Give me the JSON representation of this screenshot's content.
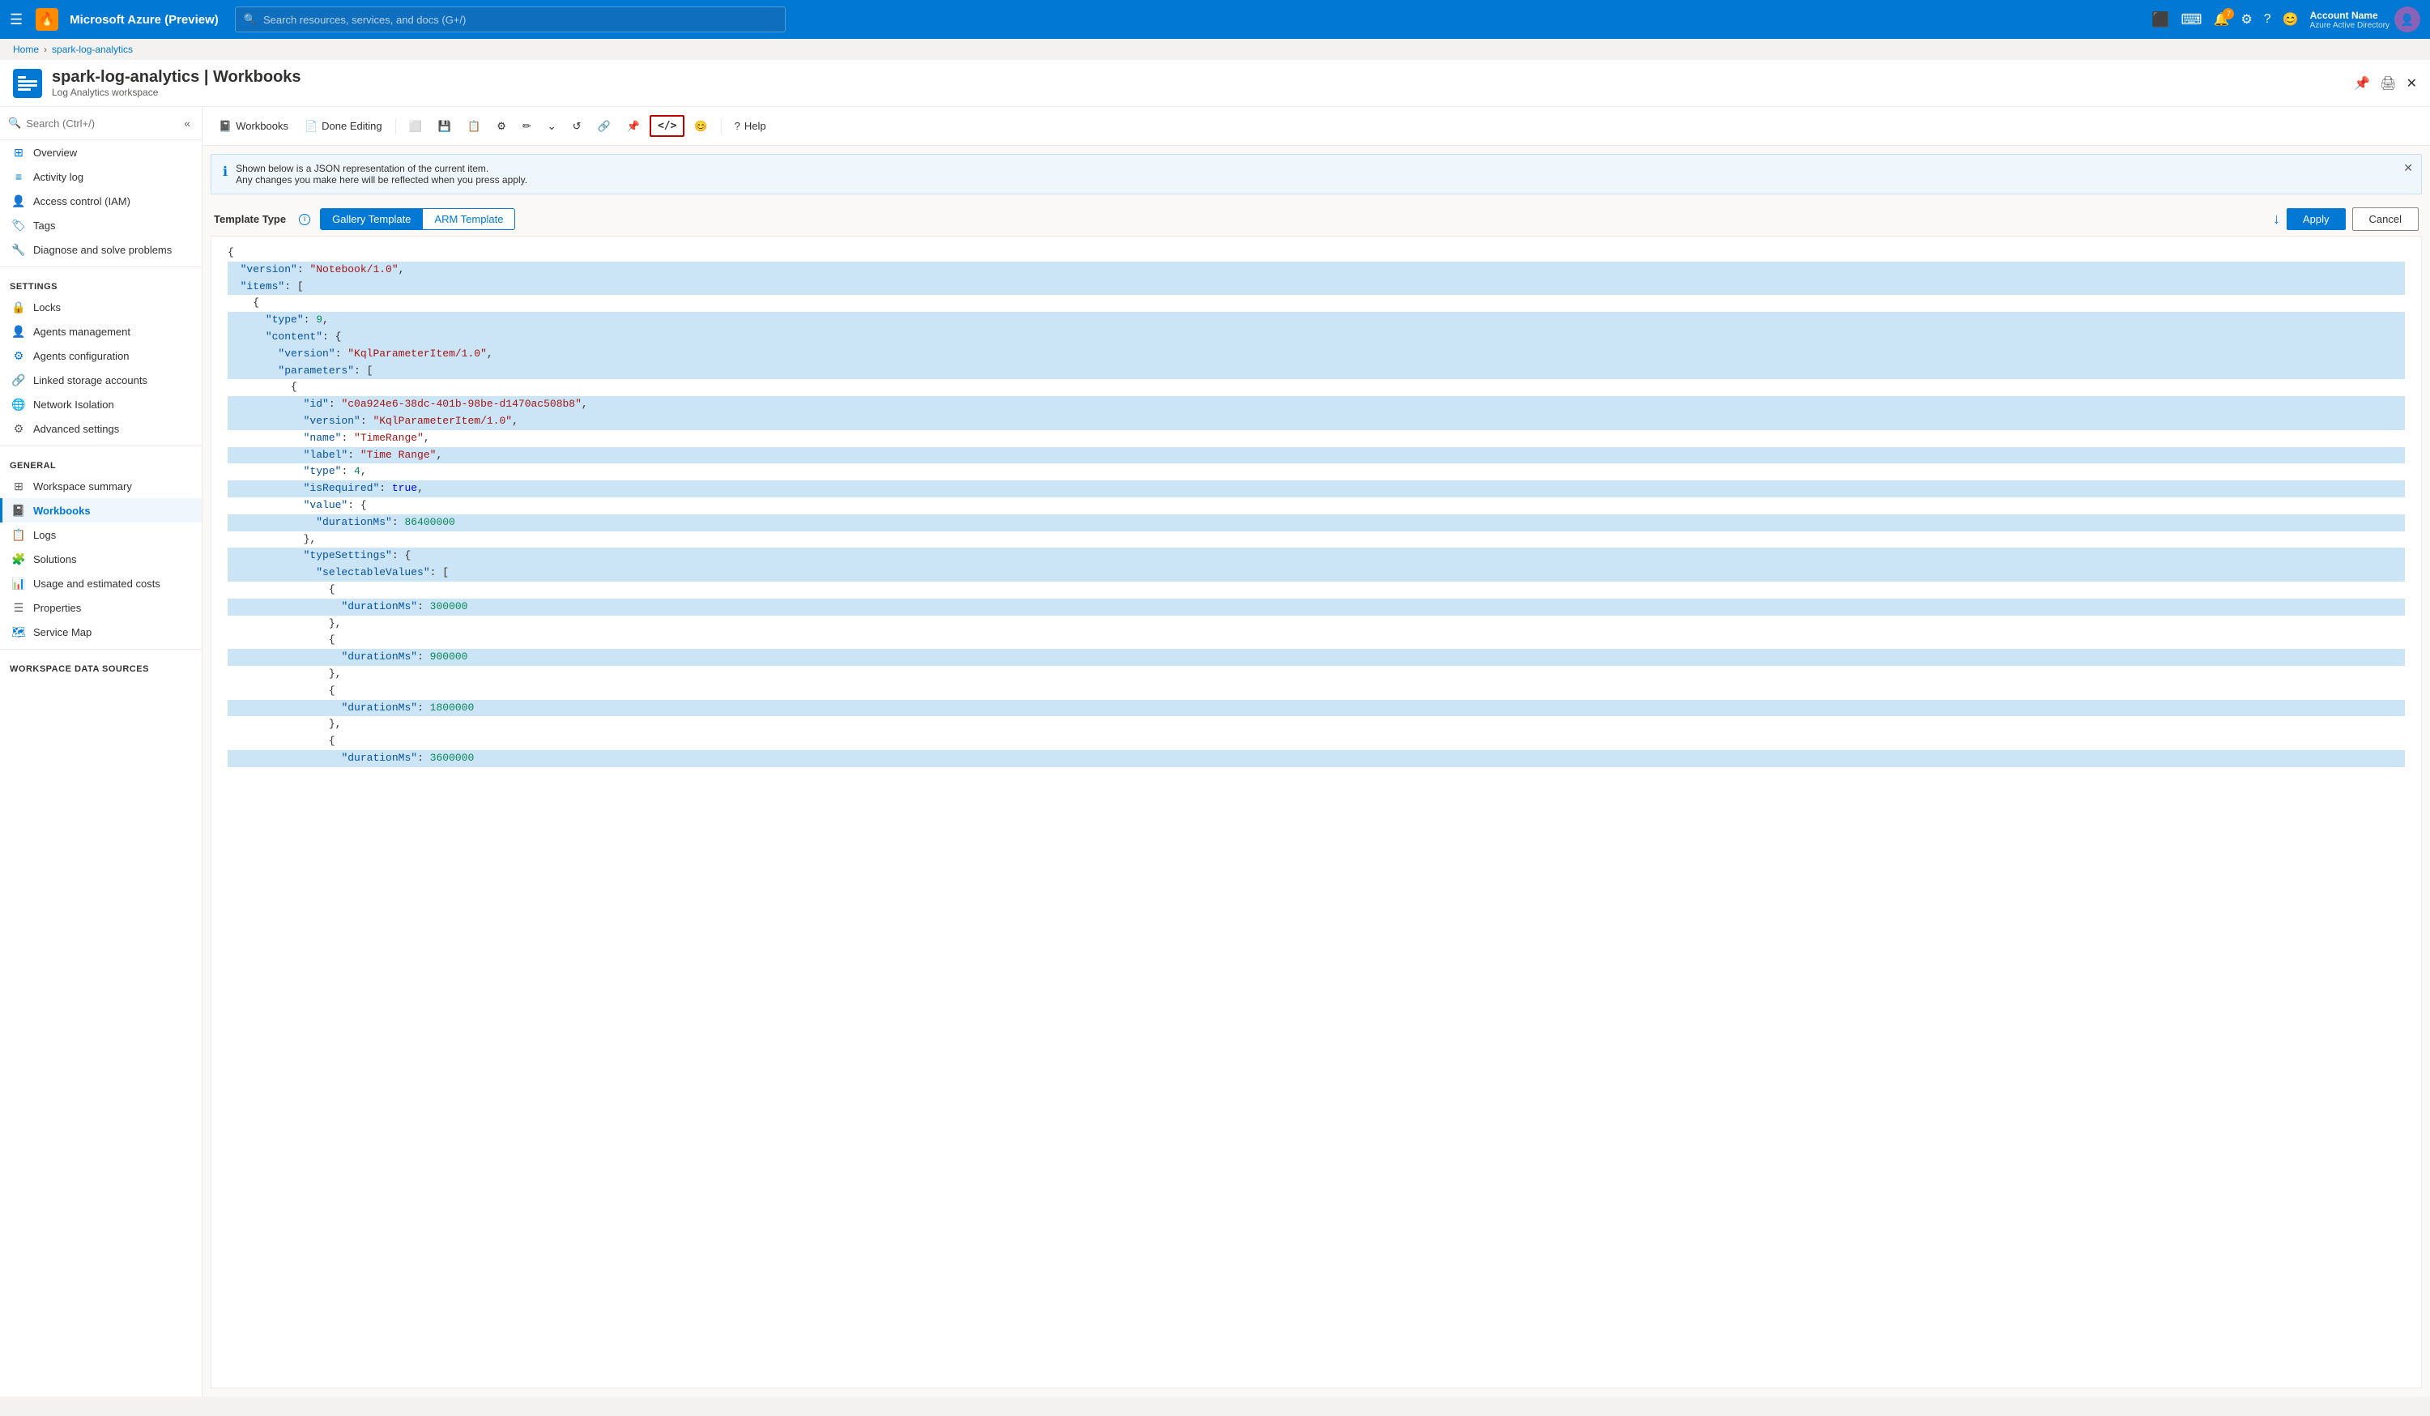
{
  "topnav": {
    "brand": "Microsoft Azure (Preview)",
    "search_placeholder": "Search resources, services, and docs (G+/)",
    "account_name": "Account Name",
    "account_subtitle": "Azure Active Directory",
    "notif_count": "7"
  },
  "breadcrumb": {
    "home": "Home",
    "resource": "spark-log-analytics"
  },
  "resource": {
    "title": "spark-log-analytics | Workbooks",
    "subtitle": "Log Analytics workspace",
    "close_label": "✕"
  },
  "toolbar": {
    "workbooks_label": "Workbooks",
    "done_editing_label": "Done Editing",
    "help_label": "Help"
  },
  "info_banner": {
    "line1": "Shown below is a JSON representation of the current item.",
    "line2": "Any changes you make here will be reflected when you press apply."
  },
  "template_type": {
    "label": "Template Type",
    "tab1": "Gallery Template",
    "tab2": "ARM Template",
    "apply_label": "Apply",
    "cancel_label": "Cancel"
  },
  "sidebar": {
    "search_placeholder": "Search (Ctrl+/)",
    "items": [
      {
        "id": "overview",
        "label": "Overview",
        "icon": "grid",
        "color": "blue"
      },
      {
        "id": "activity-log",
        "label": "Activity log",
        "icon": "list",
        "color": "blue"
      },
      {
        "id": "access-control",
        "label": "Access control (IAM)",
        "icon": "person-star",
        "color": "purple"
      },
      {
        "id": "tags",
        "label": "Tags",
        "icon": "tag",
        "color": "blue"
      },
      {
        "id": "diagnose",
        "label": "Diagnose and solve problems",
        "icon": "wrench",
        "color": "gray"
      }
    ],
    "settings_section": "Settings",
    "settings_items": [
      {
        "id": "locks",
        "label": "Locks",
        "icon": "lock",
        "color": "blue"
      },
      {
        "id": "agents-management",
        "label": "Agents management",
        "icon": "person-gear",
        "color": "blue"
      },
      {
        "id": "agents-configuration",
        "label": "Agents configuration",
        "icon": "gear",
        "color": "blue"
      },
      {
        "id": "linked-storage",
        "label": "Linked storage accounts",
        "icon": "link",
        "color": "teal"
      },
      {
        "id": "network-isolation",
        "label": "Network Isolation",
        "icon": "network",
        "color": "blue"
      },
      {
        "id": "advanced-settings",
        "label": "Advanced settings",
        "icon": "gear",
        "color": "gray"
      }
    ],
    "general_section": "General",
    "general_items": [
      {
        "id": "workspace-summary",
        "label": "Workspace summary",
        "icon": "grid-small",
        "color": "gray"
      },
      {
        "id": "workbooks",
        "label": "Workbooks",
        "icon": "workbook",
        "color": "blue",
        "active": true
      },
      {
        "id": "logs",
        "label": "Logs",
        "icon": "logs",
        "color": "blue"
      },
      {
        "id": "solutions",
        "label": "Solutions",
        "icon": "puzzle",
        "color": "green"
      },
      {
        "id": "usage-costs",
        "label": "Usage and estimated costs",
        "icon": "chart",
        "color": "blue"
      },
      {
        "id": "properties",
        "label": "Properties",
        "icon": "list-details",
        "color": "gray"
      },
      {
        "id": "service-map",
        "label": "Service Map",
        "icon": "service-map",
        "color": "blue"
      }
    ],
    "workspace_datasources": "Workspace Data Sources"
  },
  "json_content": {
    "lines": [
      {
        "text": "{",
        "selected": false
      },
      {
        "text": "  \"version\": \"Notebook/1.0\",",
        "selected": true
      },
      {
        "text": "  \"items\": [",
        "selected": true
      },
      {
        "text": "    {",
        "selected": false
      },
      {
        "text": "      \"type\": 9,",
        "selected": true
      },
      {
        "text": "      \"content\": {",
        "selected": true
      },
      {
        "text": "        \"version\": \"KqlParameterItem/1.0\",",
        "selected": true
      },
      {
        "text": "        \"parameters\": [",
        "selected": true
      },
      {
        "text": "          {",
        "selected": false
      },
      {
        "text": "            \"id\": \"c0a924e6-38dc-401b-98be-d1470ac508b8\",",
        "selected": true
      },
      {
        "text": "            \"version\": \"KqlParameterItem/1.0\",",
        "selected": true
      },
      {
        "text": "            \"name\": \"TimeRange\",",
        "selected": false
      },
      {
        "text": "            \"label\": \"Time Range\",",
        "selected": true
      },
      {
        "text": "            \"type\": 4,",
        "selected": false
      },
      {
        "text": "            \"isRequired\": true,",
        "selected": true
      },
      {
        "text": "            \"value\": {",
        "selected": false
      },
      {
        "text": "              \"durationMs\": 86400000",
        "selected": true
      },
      {
        "text": "            },",
        "selected": false
      },
      {
        "text": "            \"typeSettings\": {",
        "selected": true
      },
      {
        "text": "              \"selectableValues\": [",
        "selected": true
      },
      {
        "text": "                {",
        "selected": false
      },
      {
        "text": "                  \"durationMs\": 300000",
        "selected": true
      },
      {
        "text": "                },",
        "selected": false
      },
      {
        "text": "                {",
        "selected": false
      },
      {
        "text": "                  \"durationMs\": 900000",
        "selected": true
      },
      {
        "text": "                },",
        "selected": false
      },
      {
        "text": "                {",
        "selected": false
      },
      {
        "text": "                  \"durationMs\": 1800000",
        "selected": true
      },
      {
        "text": "                },",
        "selected": false
      },
      {
        "text": "                {",
        "selected": false
      },
      {
        "text": "                  \"durationMs\": 3600000",
        "selected": true
      }
    ]
  }
}
